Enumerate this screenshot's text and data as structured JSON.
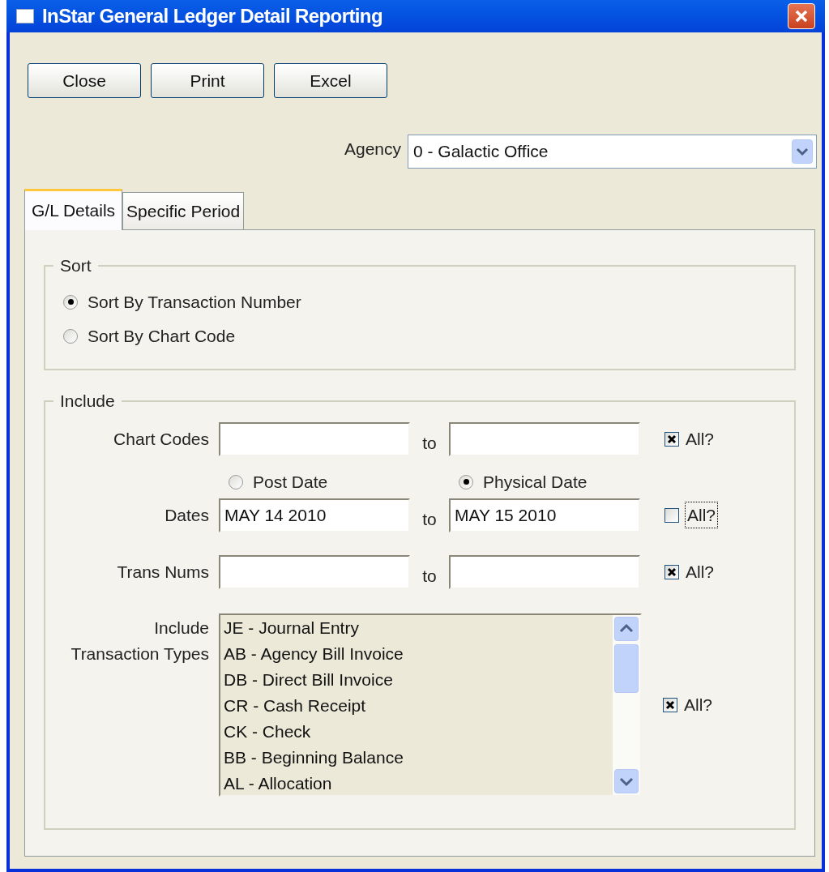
{
  "window": {
    "title": "InStar General Ledger Detail Reporting"
  },
  "buttons": [
    "Close",
    "Print",
    "Excel"
  ],
  "agency": {
    "label": "Agency",
    "value": "0 - Galactic Office"
  },
  "tabs": [
    {
      "label": "G/L Details",
      "selected": true
    },
    {
      "label": "Specific Period",
      "selected": false
    }
  ],
  "sort": {
    "title": "Sort",
    "options": [
      {
        "label": "Sort By Transaction Number",
        "selected": true
      },
      {
        "label": "Sort By Chart Code",
        "selected": false
      }
    ]
  },
  "include": {
    "title": "Include",
    "chart_codes": {
      "label": "Chart Codes",
      "to_label": "to",
      "all_label": "All?",
      "all_checked": true,
      "focused": false
    },
    "date_type": [
      {
        "label": "Post Date",
        "selected": false
      },
      {
        "label": "Physical Date",
        "selected": true
      }
    ],
    "dates": {
      "label": "Dates",
      "from": "MAY 14 2010",
      "to_label": "to",
      "to": "MAY 15 2010",
      "all_label": "All?",
      "all_checked": false,
      "focused": true
    },
    "trans_nums": {
      "label": "Trans Nums",
      "to_label": "to",
      "all_label": "All?",
      "all_checked": true,
      "focused": false
    },
    "transaction_types": {
      "label_lines": [
        "Include",
        "Transaction Types"
      ],
      "items": [
        "JE - Journal Entry",
        "AB - Agency Bill Invoice",
        "DB - Direct Bill Invoice",
        "CR - Cash Receipt",
        "CK - Check",
        "BB - Beginning Balance",
        "AL - Allocation"
      ],
      "all_label": "All?",
      "all_checked": true
    }
  }
}
